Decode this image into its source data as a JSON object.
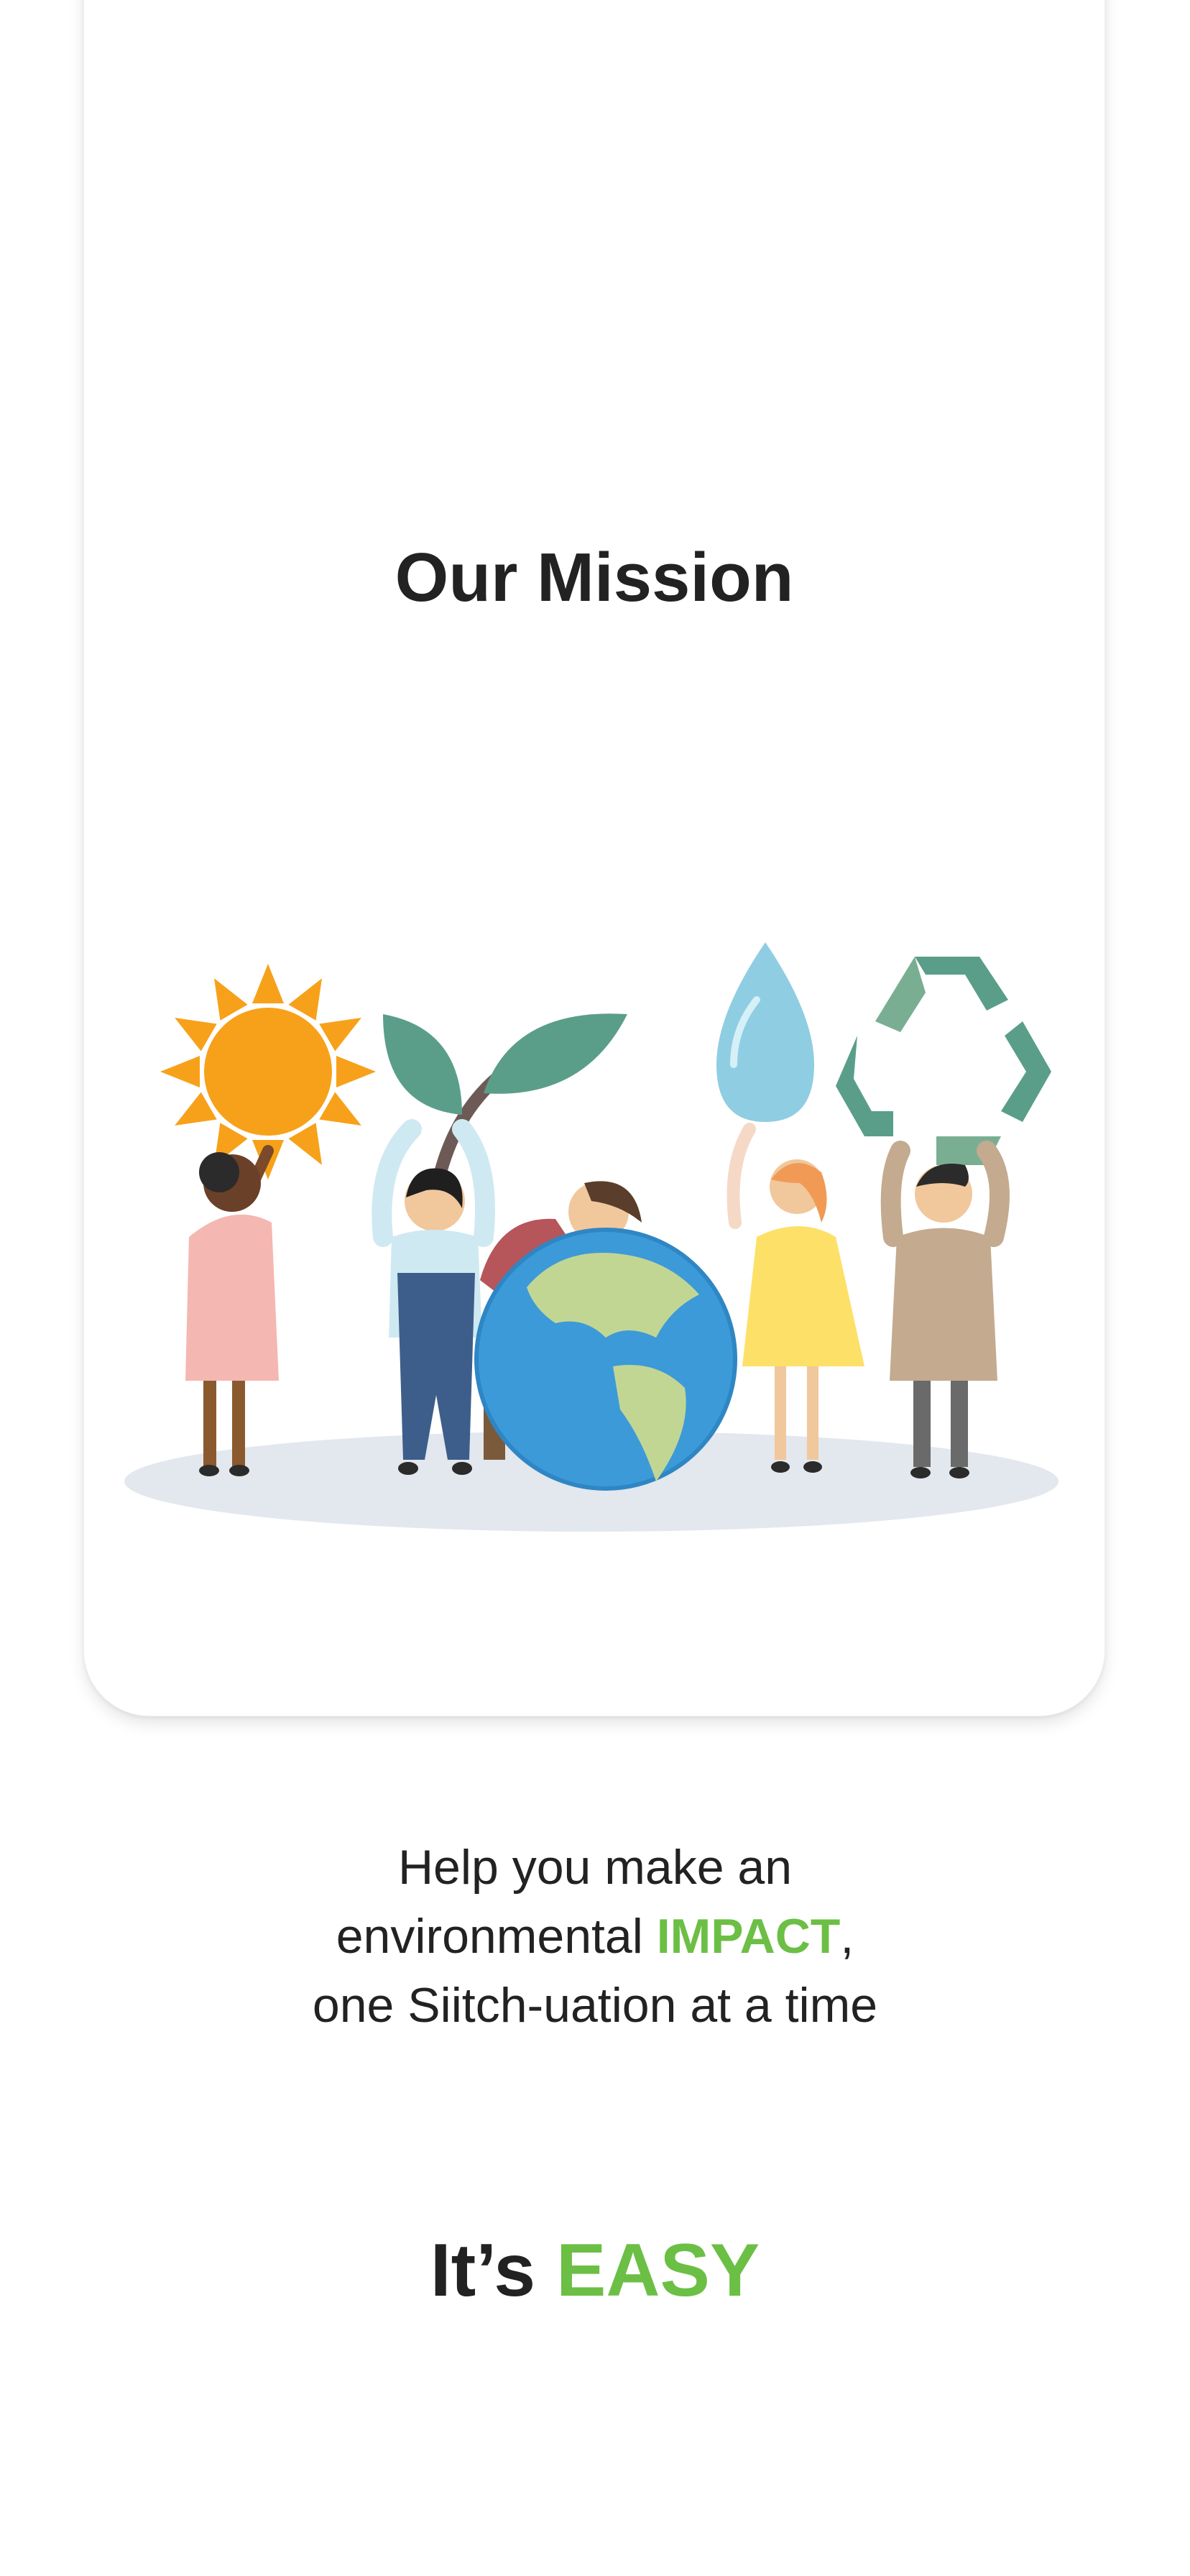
{
  "card": {
    "title": "Our Mission"
  },
  "mission": {
    "line1": "Help you make an",
    "line2_prefix": "environmental ",
    "line2_accent": "IMPACT",
    "line2_suffix": ",",
    "line3": "one Siitch-uation at a time"
  },
  "tagline": {
    "prefix": "It’s ",
    "accent": "EASY"
  },
  "colors": {
    "accent": "#6cbf45",
    "text": "#222222"
  },
  "illustration": {
    "icons": [
      "sun-icon",
      "plant-icon",
      "globe-icon",
      "water-drop-icon",
      "recycle-icon"
    ]
  }
}
